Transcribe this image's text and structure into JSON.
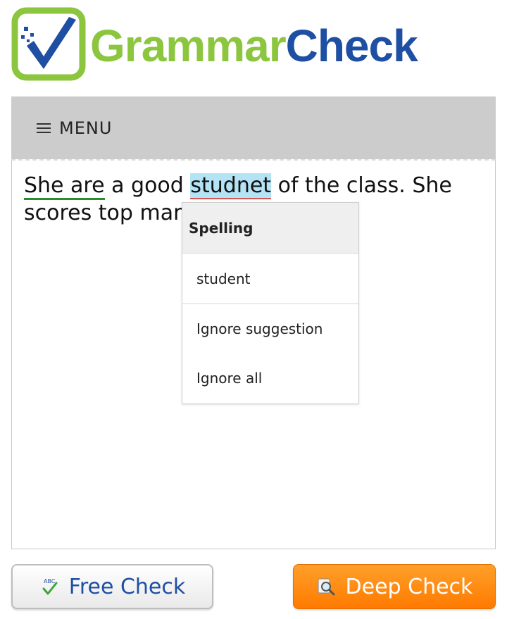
{
  "header": {
    "logo_part1": "Grammar",
    "logo_part2": "Check"
  },
  "menu": {
    "label": "MENU",
    "icon": "hamburger-icon"
  },
  "editor": {
    "segments": {
      "grammar_error": "She are",
      "t1": " a good ",
      "spelling_error": "studnet",
      "t2": " of the class. She scores top marks"
    }
  },
  "popup": {
    "title": "Spelling",
    "suggestion": "student",
    "ignore": "Ignore suggestion",
    "ignore_all": "Ignore all"
  },
  "buttons": {
    "free_check": "Free Check",
    "free_icon": "abc-check-icon",
    "deep_check": "Deep Check",
    "deep_icon": "magnifier-icon"
  },
  "colors": {
    "brand_green": "#8cc63f",
    "brand_blue": "#1f4fa3",
    "menu_bg": "#cccccc",
    "spelling_highlight": "#b3e3f4",
    "grammar_underline": "#2e8b2e",
    "deep_button": "#ff8c00"
  }
}
